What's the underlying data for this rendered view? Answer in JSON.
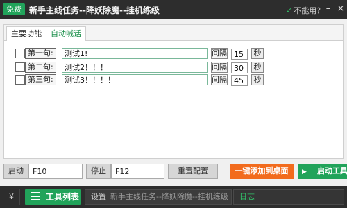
{
  "titlebar": {
    "badge": "免费",
    "title": "新手主线任务--降妖除魔--挂机练级",
    "cant_use_icon": "check-icon",
    "cant_use": "不能用？",
    "minimize": "–",
    "close": "×"
  },
  "tabs": [
    {
      "label": "主要功能",
      "active": false
    },
    {
      "label": "自动喊话",
      "active": true
    }
  ],
  "shout_rows": [
    {
      "label": "第一句:",
      "message": "测试1!",
      "interval_label": "间隔",
      "interval": "15",
      "unit": "秒",
      "checked": false
    },
    {
      "label": "第二句:",
      "message": "测试2！！！",
      "interval_label": "间隔",
      "interval": "30",
      "unit": "秒",
      "checked": false
    },
    {
      "label": "第三句:",
      "message": "测试3！！！！",
      "interval_label": "间隔",
      "interval": "45",
      "unit": "秒",
      "checked": false
    }
  ],
  "controls": {
    "start_label": "启动",
    "start_key": "F10",
    "stop_label": "停止",
    "stop_key": "F12",
    "reset_label": "重置配置",
    "add_desktop_label": "一键添加到桌面",
    "start_tool_label": "启动工具"
  },
  "statusbar": {
    "collapse_icon": "chevron-down-double-icon",
    "collapse_glyph": "¥",
    "tool_list_label": "工具列表",
    "settings_label": "设置",
    "settings_path": "新手主线任务--降妖除魔--挂机练级",
    "log_label": "日志"
  },
  "colors": {
    "accent_green": "#21a35a",
    "accent_orange": "#f26b1d",
    "titlebar_bg": "#2d2d2d"
  }
}
